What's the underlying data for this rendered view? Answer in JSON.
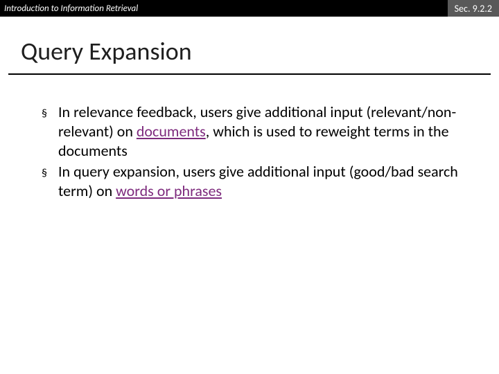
{
  "header": {
    "left": "Introduction to Information Retrieval",
    "right": "Sec. 9.2.2"
  },
  "title": "Query Expansion",
  "bullets": [
    {
      "pre": "In relevance feedback, users give additional input (relevant/non-relevant) on ",
      "underlined": "documents",
      "post": ", which is used to reweight terms in the documents"
    },
    {
      "pre": "In query expansion, users give additional input (good/bad search term) on ",
      "underlined": "words or phrases",
      "post": ""
    }
  ]
}
